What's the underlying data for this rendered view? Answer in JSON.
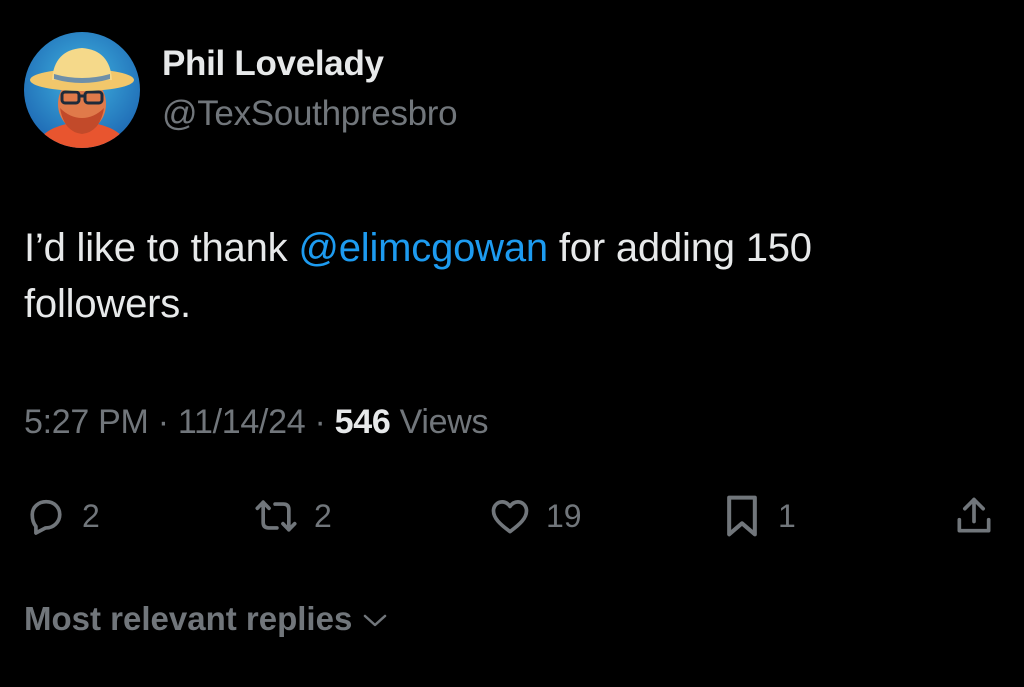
{
  "user": {
    "display_name": "Phil Lovelady",
    "handle": "@TexSouthpresbro"
  },
  "tweet": {
    "text_before": "I’d like to thank ",
    "mention": "@elimcgowan",
    "text_after": " for adding 150 followers."
  },
  "meta": {
    "time": "5:27 PM",
    "date": "11/14/24",
    "separator": "·",
    "views_count": "546",
    "views_label": "Views"
  },
  "actions": {
    "reply": {
      "icon": "reply-icon",
      "count": "2"
    },
    "retweet": {
      "icon": "retweet-icon",
      "count": "2"
    },
    "like": {
      "icon": "heart-icon",
      "count": "19"
    },
    "bookmark": {
      "icon": "bookmark-icon",
      "count": "1"
    },
    "share": {
      "icon": "share-icon"
    }
  },
  "replies_sort": {
    "label": "Most relevant replies"
  },
  "colors": {
    "background": "#000000",
    "text": "#e7e9ea",
    "secondary": "#71767b",
    "link": "#1d9bf0"
  }
}
